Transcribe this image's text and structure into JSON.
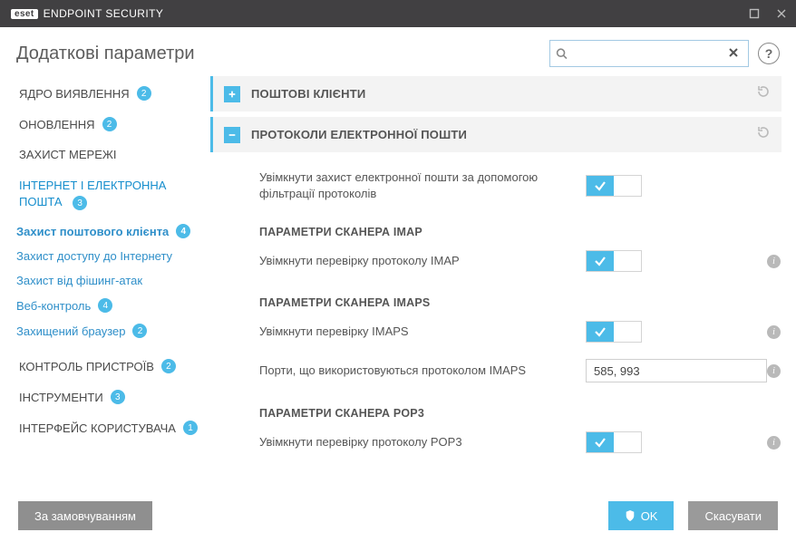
{
  "titlebar": {
    "brand_eset": "eset",
    "brand_product": "ENDPOINT SECURITY"
  },
  "header": {
    "title": "Додаткові параметри",
    "search_placeholder": "",
    "help": "?"
  },
  "sidebar": {
    "items": [
      {
        "label": "ЯДРО ВИЯВЛЕННЯ",
        "badge": "2"
      },
      {
        "label": "ОНОВЛЕННЯ",
        "badge": "2"
      },
      {
        "label": "ЗАХИСТ МЕРЕЖІ",
        "badge": ""
      },
      {
        "label": "ІНТЕРНЕТ І ЕЛЕКТРОННА ПОШТА",
        "badge": "3",
        "sub": [
          {
            "label": "Захист поштового клієнта",
            "badge": "4"
          },
          {
            "label": "Захист доступу до Інтернету",
            "badge": ""
          },
          {
            "label": "Захист від фішинг-атак",
            "badge": ""
          },
          {
            "label": "Веб-контроль",
            "badge": "4"
          },
          {
            "label": "Захищений браузер",
            "badge": "2"
          }
        ]
      },
      {
        "label": "КОНТРОЛЬ ПРИСТРОЇВ",
        "badge": "2"
      },
      {
        "label": "ІНСТРУМЕНТИ",
        "badge": "3"
      },
      {
        "label": "ІНТЕРФЕЙС КОРИСТУВАЧА",
        "badge": "1"
      }
    ]
  },
  "sections": {
    "mail_clients": {
      "title": "ПОШТОВІ КЛІЄНТИ"
    },
    "protocols": {
      "title": "ПРОТОКОЛИ ЕЛЕКТРОННОЇ ПОШТИ",
      "enable_label": "Увімкнути захист електронної пошти за допомогою фільтрації протоколів",
      "imap_hdr": "ПАРАМЕТРИ СКАНЕРА IMAP",
      "imap_enable": "Увімкнути перевірку протоколу IMAP",
      "imaps_hdr": "ПАРАМЕТРИ СКАНЕРА IMAPS",
      "imaps_enable": "Увімкнути перевірку IMAPS",
      "imaps_ports_label": "Порти, що використовуються протоколом IMAPS",
      "imaps_ports_value": "585, 993",
      "pop3_hdr": "ПАРАМЕТРИ СКАНЕРА POP3",
      "pop3_enable": "Увімкнути перевірку протоколу POP3"
    }
  },
  "footer": {
    "defaults": "За замовчуванням",
    "ok": "OK",
    "cancel": "Скасувати"
  }
}
